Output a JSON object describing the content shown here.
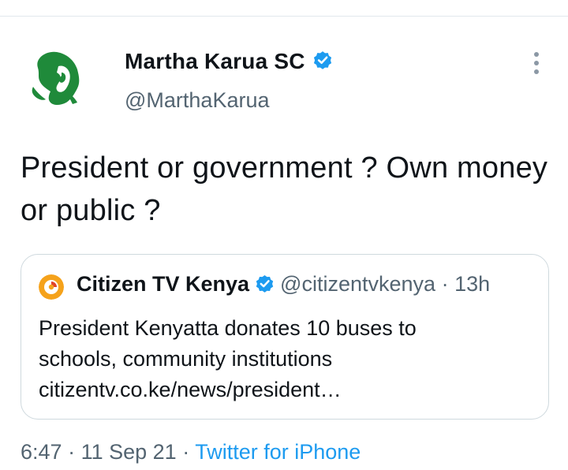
{
  "author": {
    "name": "Martha Karua SC",
    "handle": "@MarthaKarua",
    "verified": true
  },
  "tweet": {
    "text": "President or government ? Own money or public ?"
  },
  "quoted_tweet": {
    "name": "Citizen TV Kenya",
    "handle": "@citizentvkenya",
    "separator": "·",
    "time": "13h",
    "verified": true,
    "text_line1": "President Kenyatta donates 10 buses to",
    "text_line2": "schools, community institutions",
    "text_line3": "citizentv.co.ke/news/president…"
  },
  "footer": {
    "time": "6:47",
    "dot1": "·",
    "date": "11 Sep 21",
    "dot2": "·",
    "source": "Twitter for iPhone"
  },
  "icons": {
    "verified": "verified-badge-icon",
    "more": "more-vertical-icon"
  },
  "colors": {
    "verified_blue": "#1d9bf0",
    "secondary_text": "#536471",
    "avatar_green": "#1f8a3a",
    "citizen_orange": "#f5a21b"
  }
}
